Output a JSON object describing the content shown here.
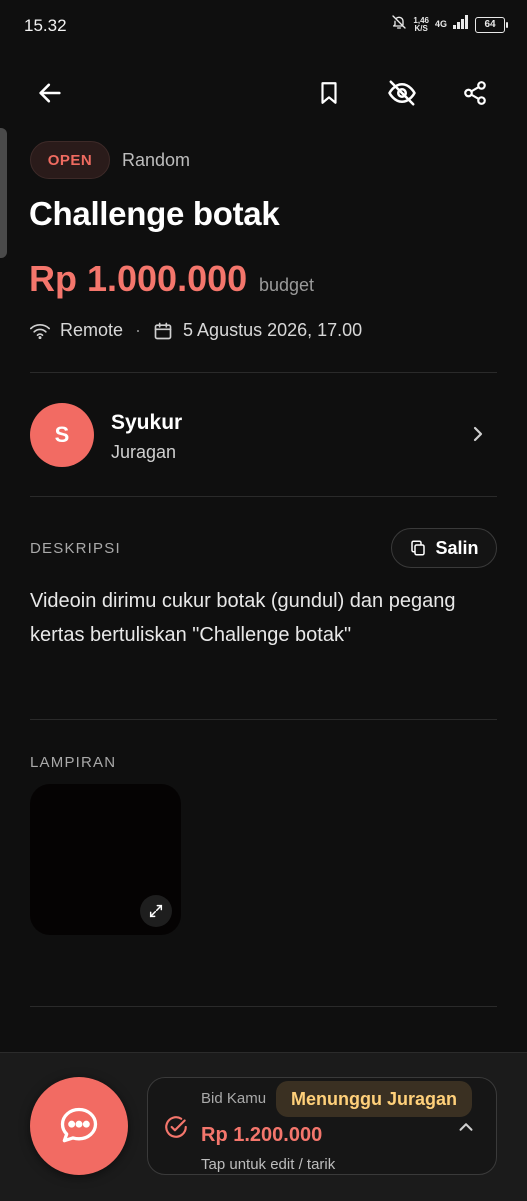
{
  "status_bar": {
    "time": "15.32",
    "net_speed_value": "1,46",
    "net_speed_unit": "K/S",
    "network": "4G",
    "battery": "64"
  },
  "header": {
    "back_icon": "arrow-left-icon",
    "bookmark_icon": "bookmark-icon",
    "hide_icon": "eye-off-icon",
    "share_icon": "share-icon"
  },
  "job": {
    "status": "OPEN",
    "category": "Random",
    "title": "Challenge botak",
    "price": "Rp 1.000.000",
    "price_suffix": "budget",
    "location": "Remote",
    "deadline": "5 Agustus 2026, 17.00"
  },
  "owner": {
    "initial": "S",
    "name": "Syukur",
    "role": "Juragan"
  },
  "description": {
    "label": "DESKRIPSI",
    "copy_label": "Salin",
    "text": "Videoin dirimu cukur botak (gundul) dan pegang kertas bertuliskan \"Challenge botak\""
  },
  "attachments": {
    "label": "LAMPIRAN"
  },
  "bid": {
    "label": "Bid Kamu",
    "status": "Menunggu Juragan",
    "amount": "Rp 1.200.000",
    "hint": "Tap untuk edit / tarik"
  },
  "colors": {
    "background": "#0f0f0f",
    "accent": "#f26b63",
    "price": "#f4766c",
    "status_pending": "#ffd07a"
  }
}
